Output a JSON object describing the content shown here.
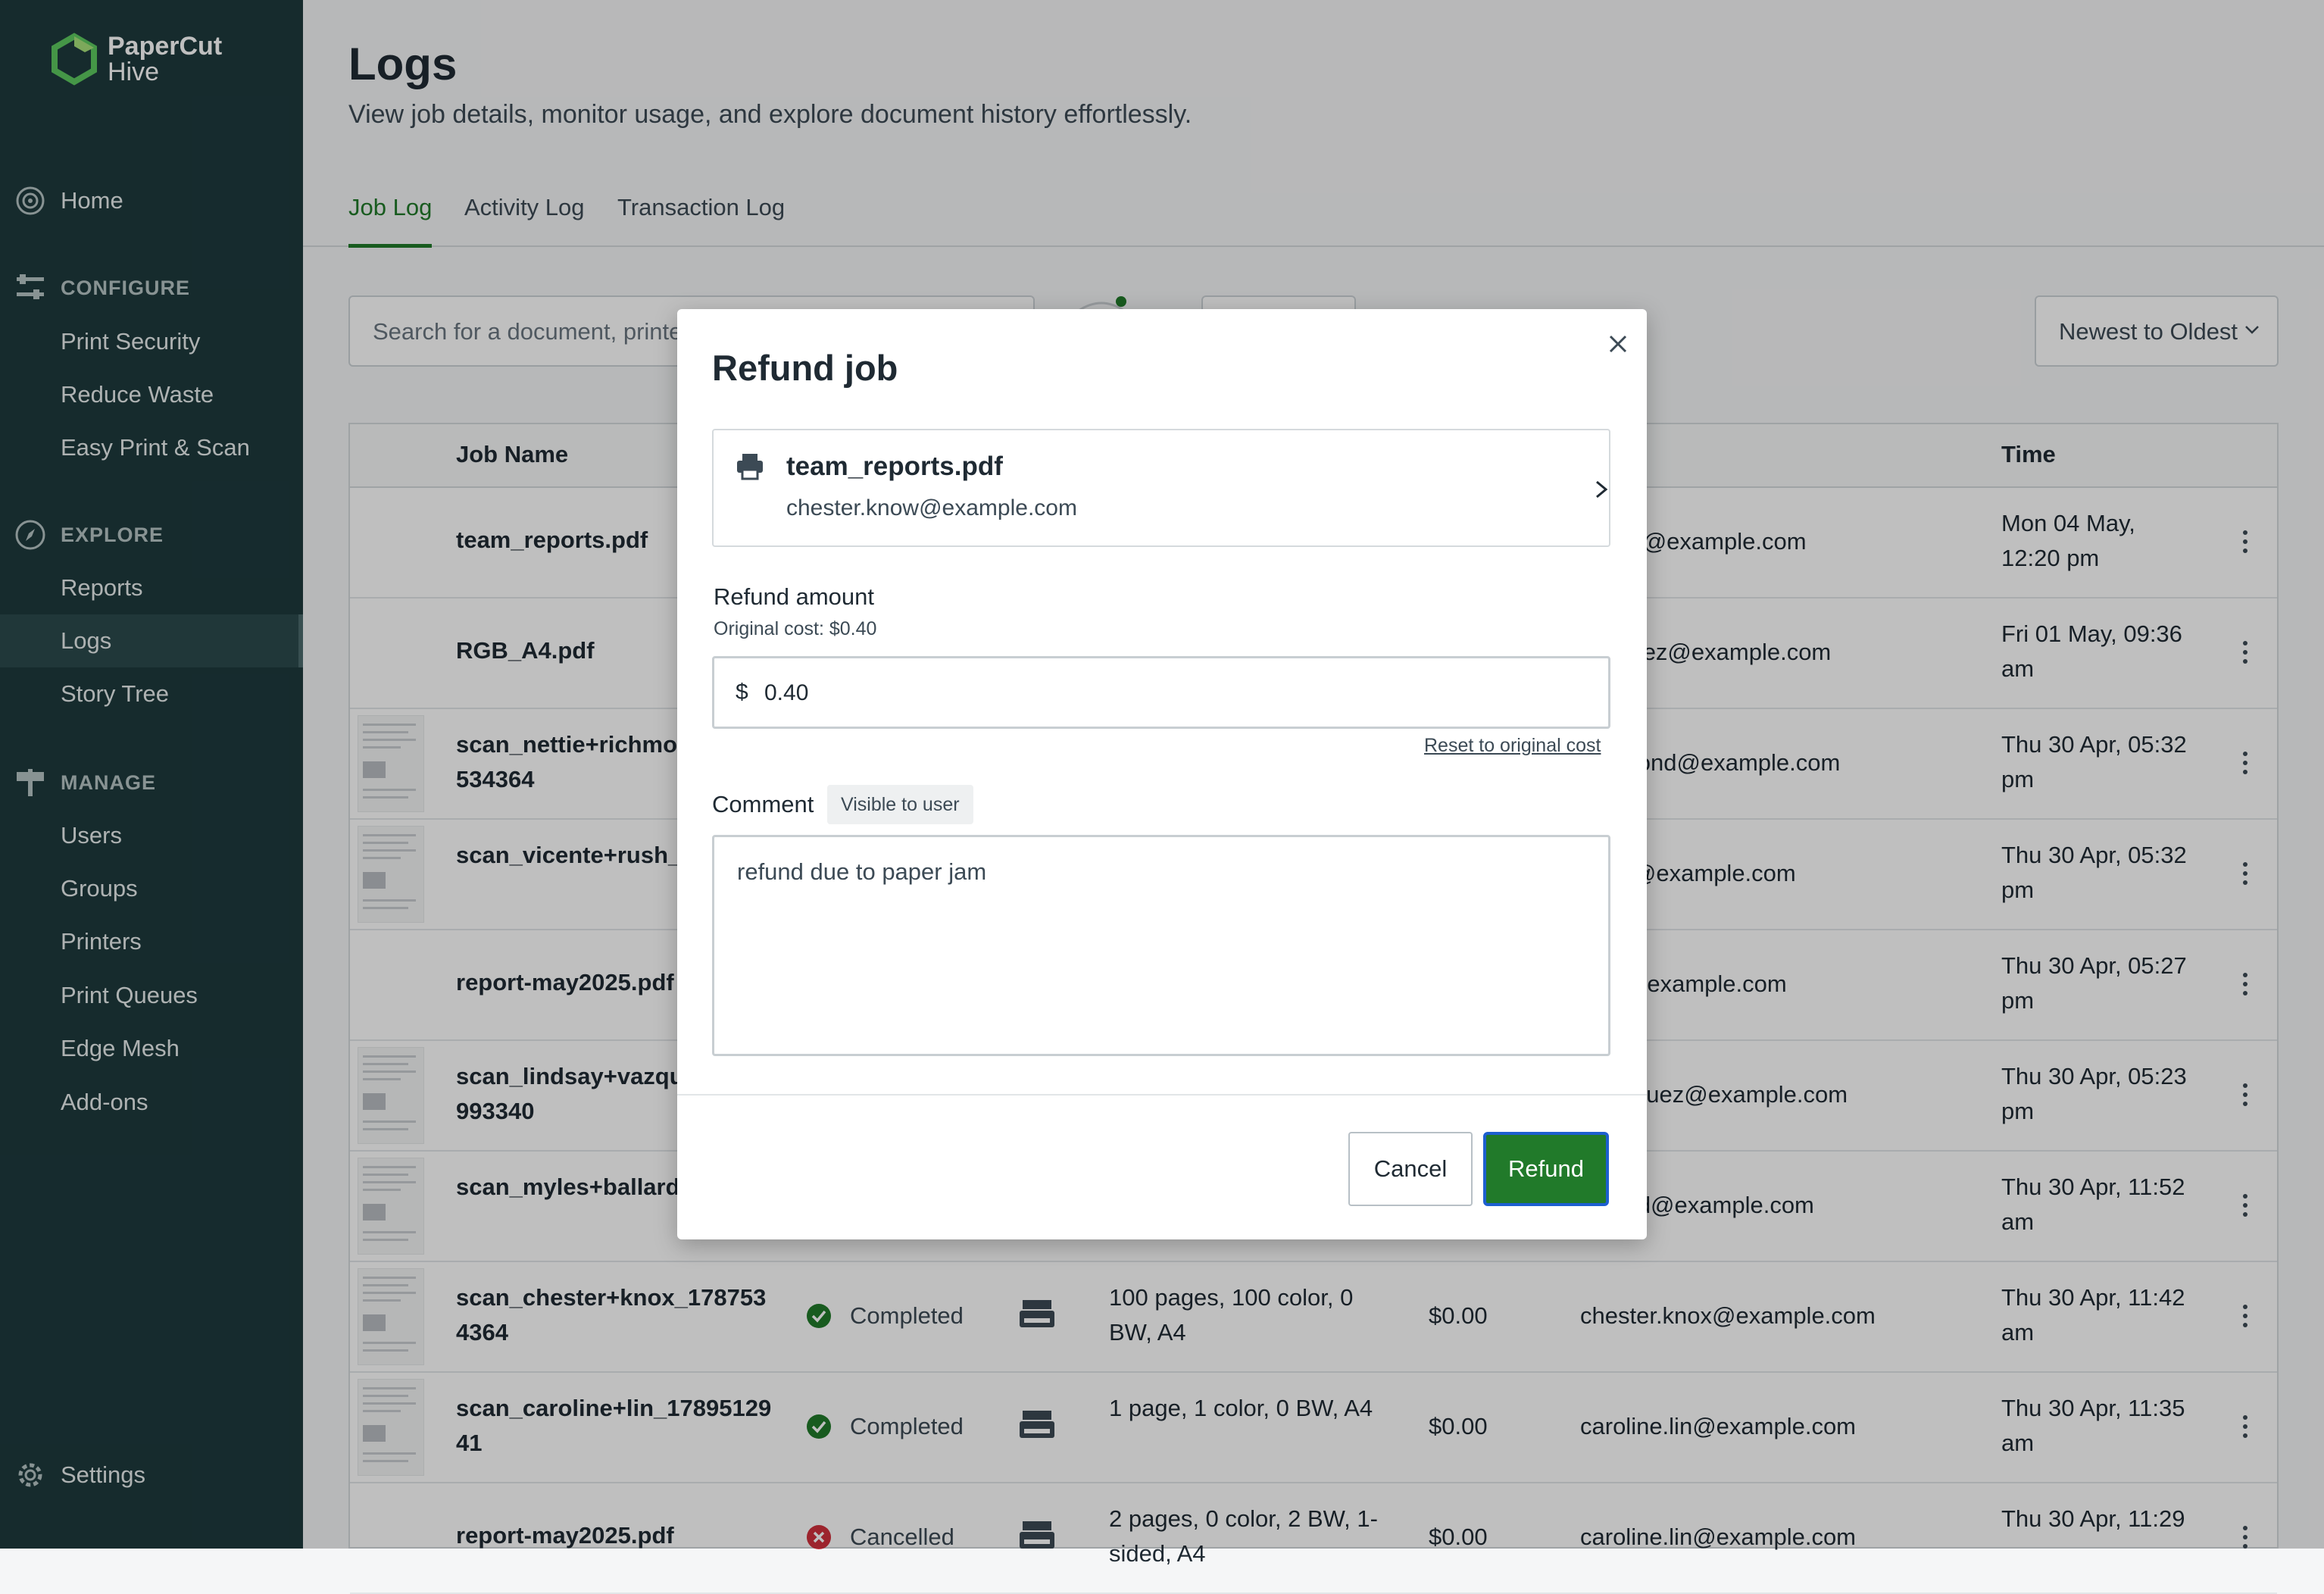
{
  "app": {
    "logo_line1": "PaperCut",
    "logo_line2": "Hive"
  },
  "sidebar": {
    "home": "Home",
    "configure": {
      "header": "CONFIGURE",
      "items": [
        "Print Security",
        "Reduce Waste",
        "Easy Print & Scan"
      ]
    },
    "explore": {
      "header": "EXPLORE",
      "items": [
        "Reports",
        "Logs",
        "Story Tree"
      ]
    },
    "manage": {
      "header": "MANAGE",
      "items": [
        "Users",
        "Groups",
        "Printers",
        "Print Queues",
        "Edge Mesh",
        "Add-ons"
      ]
    },
    "settings": "Settings",
    "active_item": "Logs"
  },
  "page": {
    "title": "Logs",
    "subtitle": "View job details, monitor usage, and explore document history effortlessly.",
    "tabs": [
      "Job Log",
      "Activity Log",
      "Transaction Log"
    ],
    "active_tab": "Job Log",
    "search_placeholder": "Search for a document, printer",
    "sort": "Newest to Oldest"
  },
  "table": {
    "headers": {
      "job_name": "Job Name",
      "time": "Time"
    },
    "rows": [
      {
        "job": "team_reports.pdf",
        "thumb": false,
        "status": "",
        "pages": "",
        "cost": "",
        "user": "r.knox@example.com",
        "time": "Mon 04 May, 12:20 pm"
      },
      {
        "job": "RGB_A4.pdf",
        "thumb": false,
        "status": "",
        "pages": "",
        "cost": "",
        "user": ".jimenez@example.com",
        "time": "Fri 01 May, 09:36 am"
      },
      {
        "job": "scan_nettie+richmon 534364",
        "thumb": true,
        "status": "",
        "pages": "",
        "cost": "",
        "user": "richmond@example.com",
        "time": "Thu 30 Apr, 05:32 pm"
      },
      {
        "job": "scan_vicente+rush_1 8865",
        "thumb": true,
        "status": "",
        "pages": "",
        "cost": "",
        "user": ".rush@example.com",
        "time": "Thu 30 Apr, 05:32 pm"
      },
      {
        "job": "report-may2025.pdf",
        "thumb": false,
        "status": "",
        "pages": "",
        "cost": "",
        "user": "e.lin@example.com",
        "time": "Thu 30 Apr, 05:27 pm"
      },
      {
        "job": "scan_lindsay+vazque 993340",
        "thumb": true,
        "status": "",
        "pages": "",
        "cost": "",
        "user": "v.vazquez@example.com",
        "time": "Thu 30 Apr, 05:23 pm"
      },
      {
        "job": "scan_myles+ballard_ 8564",
        "thumb": true,
        "status": "",
        "pages": "",
        "cost": "",
        "user": "ballard@example.com",
        "time": "Thu 30 Apr, 11:52 am"
      },
      {
        "job": "scan_chester+knox_178753 4364",
        "thumb": true,
        "status": "Completed",
        "pages": "100 pages, 100 color, 0 BW, A4",
        "cost": "$0.00",
        "user": "chester.knox@example.com",
        "time": "Thu 30 Apr, 11:42 am"
      },
      {
        "job": "scan_caroline+lin_17895129 41",
        "thumb": true,
        "status": "Completed",
        "pages": "1 page, 1 color, 0 BW, A4",
        "cost": "$0.00",
        "user": "caroline.lin@example.com",
        "time": "Thu 30 Apr, 11:35 am"
      },
      {
        "job": "report-may2025.pdf",
        "thumb": false,
        "status": "Cancelled",
        "pages": "2 pages, 0 color, 2 BW, 1-sided, A4",
        "cost": "$0.00",
        "user": "caroline.lin@example.com",
        "time": "Thu 30 Apr, 11:29"
      }
    ]
  },
  "modal": {
    "title": "Refund job",
    "job_name": "team_reports.pdf",
    "job_user": "chester.know@example.com",
    "refund_amount_label": "Refund amount",
    "original_cost": "Original cost: $0.40",
    "currency": "$",
    "amount_value": "0.40",
    "reset_link": "Reset to original cost",
    "comment_label": "Comment",
    "visible_badge": "Visible to user",
    "comment_value": "refund due to paper jam",
    "cancel": "Cancel",
    "refund": "Refund"
  },
  "colors": {
    "sidebar_bg": "#1e3a3d",
    "accent_green": "#217a2a",
    "focus_blue": "#1d5fd0",
    "cancelled_red": "#d0313c"
  }
}
